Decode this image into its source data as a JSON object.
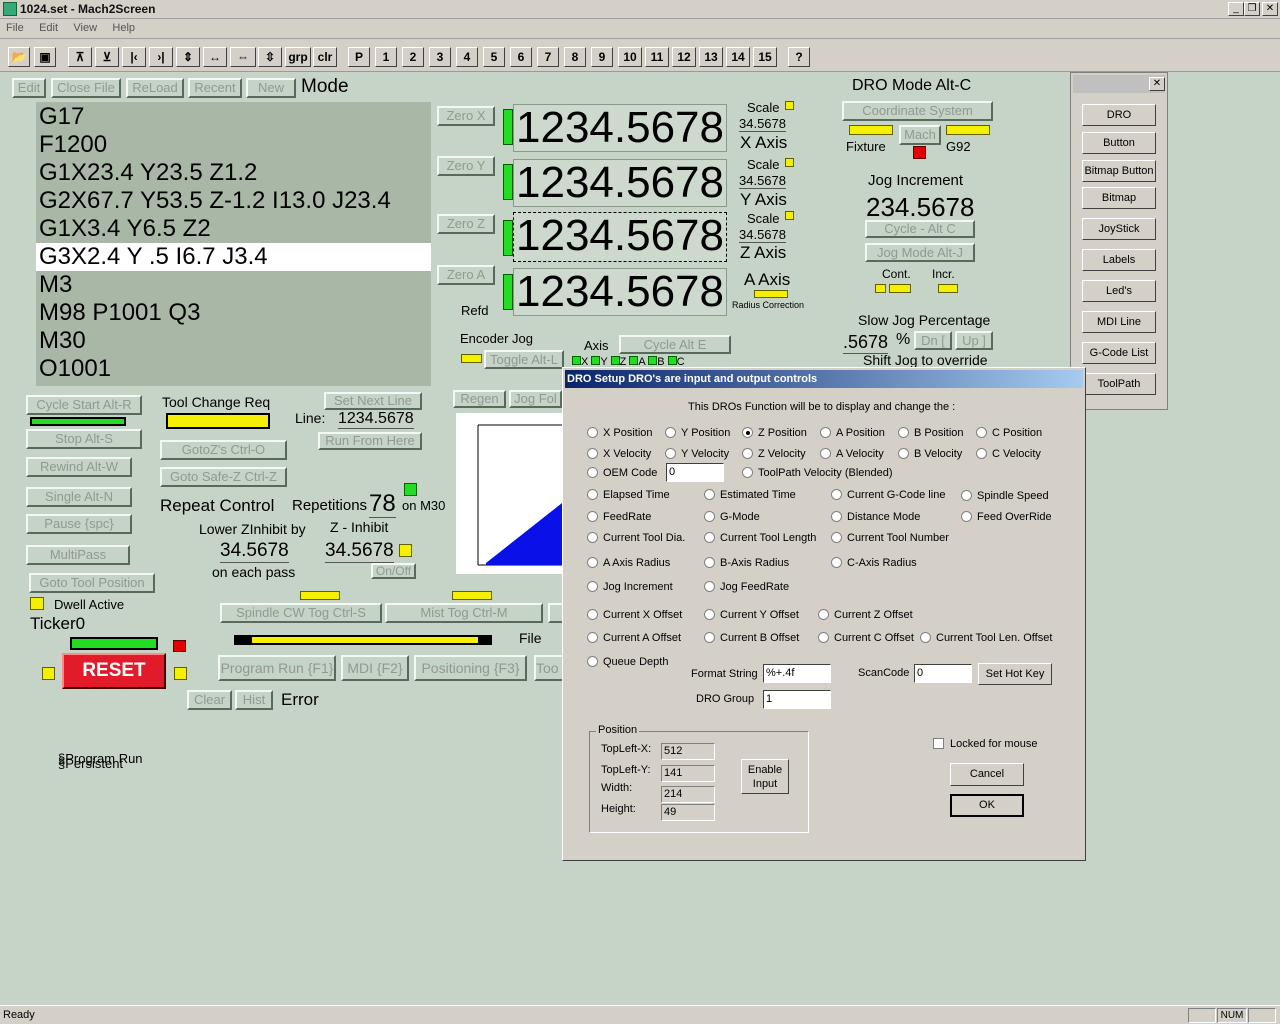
{
  "window": {
    "title": "1024.set - Mach2Screen"
  },
  "menu": [
    "File",
    "Edit",
    "View",
    "Help"
  ],
  "toolbar": {
    "grp": "grp",
    "clr": "clr",
    "p": "P",
    "nums": [
      "1",
      "2",
      "3",
      "4",
      "5",
      "6",
      "7",
      "8",
      "9",
      "10",
      "11",
      "12",
      "13",
      "14",
      "15"
    ],
    "help": "?"
  },
  "file_buttons": {
    "edit": "Edit",
    "close": "Close File",
    "reload": "ReLoad",
    "recent": "Recent",
    "new": "New",
    "mode": "Mode"
  },
  "gcode": {
    "lines": [
      "G17",
      "F1200",
      "G1X23.4 Y23.5 Z1.2",
      "G2X67.7 Y53.5 Z-1.2 I13.0 J23.4",
      "G1X3.4 Y6.5 Z2",
      "G3X2.4 Y .5 I6.7 J3.4",
      "M3",
      "M98 P1001 Q3",
      "M30",
      "O1001"
    ]
  },
  "axes": [
    {
      "zero": "Zero X",
      "value": "1234.5678",
      "scale_label": "Scale",
      "scale": "34.5678",
      "axis": "X Axis"
    },
    {
      "zero": "Zero Y",
      "value": "1234.5678",
      "scale_label": "Scale",
      "scale": "34.5678",
      "axis": "Y Axis"
    },
    {
      "zero": "Zero Z",
      "value": "1234.5678",
      "scale_label": "Scale",
      "scale": "34.5678",
      "axis": "Z Axis"
    },
    {
      "zero": "Zero A",
      "value": "1234.5678",
      "axis": "A Axis",
      "extra": "Radius Correction"
    }
  ],
  "refd": "Refd",
  "dro_mode": {
    "title": "DRO Mode Alt-C",
    "coord": "Coordinate System",
    "mach": "Mach",
    "fixture": "Fixture",
    "g92": "G92"
  },
  "jog": {
    "inc_label": "Jog Increment",
    "inc_value": "234.5678",
    "cycle": "Cycle - Alt C",
    "mode": "Jog Mode Alt-J",
    "cont": "Cont.",
    "incr": "Incr.",
    "slow_label": "Slow Jog Percentage",
    "slow_value": ".5678",
    "pct": "%",
    "dn": "Dn [",
    "up": "Up ]",
    "shift": "Shift Jog to override"
  },
  "encoder": {
    "label": "Encoder Jog",
    "toggle": "Toggle Alt-L",
    "axis": "Axis",
    "cycle": "Cycle Alt E",
    "letters": [
      "X",
      "Y",
      "Z",
      "A",
      "B",
      "C"
    ]
  },
  "controls": {
    "cycle_start": "Cycle Start Alt-R",
    "stop": "Stop Alt-S",
    "rewind": "Rewind Alt-W",
    "single": "Single Alt-N",
    "pause": "Pause {spc}",
    "multipass": "MultiPass",
    "goto_tool": "Goto Tool Position",
    "dwell": "Dwell Active",
    "ticker": "Ticker0",
    "reset": "RESET"
  },
  "tool": {
    "change_req": "Tool Change Req",
    "gotoz": "GotoZ's Ctrl-O",
    "goto_safe": "Goto Safe-Z Ctrl-Z",
    "set_next": "Set Next Line",
    "line_label": "Line:",
    "line_value": "1234.5678",
    "run_from": "Run From Here",
    "regen": "Regen",
    "jog_fol": "Jog Fol"
  },
  "repeat": {
    "label": "Repeat Control",
    "reps_label": "Repetitions",
    "reps": "78",
    "on_m30": "on M30",
    "lower": "Lower ZInhibit by",
    "lower_val": "34.5678",
    "each": "on each pass",
    "zinhibit": "Z - Inhibit",
    "zinhibit_val": "34.5678",
    "onoff": "On/Off"
  },
  "spindle": {
    "cw": "Spindle CW Tog Ctrl-S",
    "mist": "Mist Tog Ctrl-M",
    "file": "File"
  },
  "modes": {
    "program": "Program Run {F1}",
    "mdi": "MDI {F2}",
    "positioning": "Positioning {F3}",
    "tool": "Too",
    "clear": "Clear",
    "hist": "Hist",
    "error": "Error"
  },
  "bottom_text": [
    "§Program Run",
    "§Persistent"
  ],
  "side_panel": {
    "items": [
      "DRO",
      "Button",
      "Bitmap Button",
      "Bitmap",
      "JoyStick",
      "Labels",
      "Led's",
      "MDI Line",
      "G-Code List",
      "ToolPath"
    ]
  },
  "dialog": {
    "title": "DRO Setup   DRO's are input and output controls",
    "intro": "This DROs Function will be to display and change the :",
    "row1": [
      "X Position",
      "Y Position",
      "Z Position",
      "A Position",
      "B Position",
      "C Position"
    ],
    "row2": [
      "X Velocity",
      "Y Velocity",
      "Z Velocity",
      "A Velocity",
      "B Velocity",
      "C Velocity"
    ],
    "oem": "OEM Code",
    "oem_value": "0",
    "toolpath_vel": "ToolPath Velocity (Blended)",
    "grid": [
      [
        "Elapsed Time",
        "Estimated Time",
        "Current G-Code line",
        "Spindle Speed"
      ],
      [
        "FeedRate",
        "G-Mode",
        "Distance Mode",
        "Feed OverRide"
      ],
      [
        "Current Tool Dia.",
        "Current Tool Length",
        "Current Tool Number"
      ],
      [
        "A Axis Radius",
        "B-Axis Radius",
        "C-Axis Radius"
      ],
      [
        "Jog Increment",
        "Jog FeedRate"
      ]
    ],
    "offsets": [
      [
        "Current X Offset",
        "Current Y Offset",
        "Current Z Offset"
      ],
      [
        "Current A Offset",
        "Current B Offset",
        "Current C Offset",
        "Current Tool Len. Offset"
      ]
    ],
    "queue": "Queue Depth",
    "format_label": "Format String",
    "format_value": "%+.4f",
    "scancode_label": "ScanCode",
    "scancode_value": "0",
    "hotkey": "Set Hot Key",
    "group_label": "DRO Group",
    "group_value": "1",
    "position": {
      "title": "Position",
      "tlx_label": "TopLeft-X:",
      "tlx": "512",
      "tly_label": "TopLeft-Y:",
      "tly": "141",
      "w_label": "Width:",
      "w": "214",
      "h_label": "Height:",
      "h": "49",
      "enable1": "Enable",
      "enable2": "Input"
    },
    "locked": "Locked for mouse",
    "cancel": "Cancel",
    "ok": "OK"
  },
  "statusbar": {
    "ready": "Ready",
    "num": "NUM"
  }
}
